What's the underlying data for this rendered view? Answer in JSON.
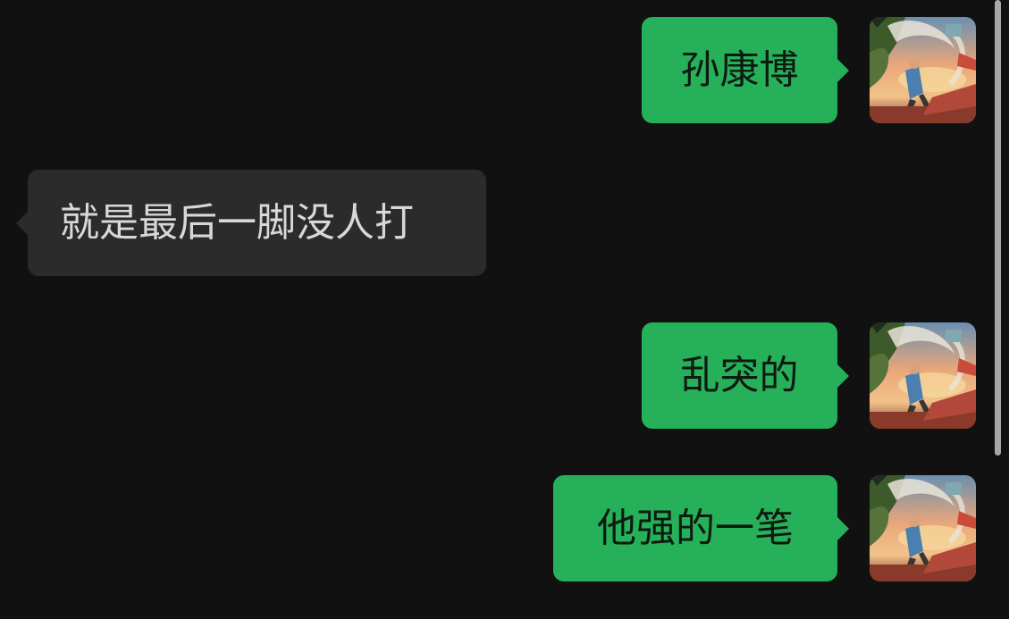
{
  "messages": [
    {
      "direction": "outgoing",
      "text": "孙康博"
    },
    {
      "direction": "incoming",
      "text": "就是最后一脚没人打"
    },
    {
      "direction": "outgoing",
      "text": "乱突的"
    },
    {
      "direction": "outgoing",
      "text": "他强的一笔"
    }
  ],
  "colors": {
    "background": "#111111",
    "outgoing_bubble": "#26b05a",
    "incoming_bubble": "#2b2b2b"
  },
  "icons": {
    "avatar": "avatar-illustration-icon"
  }
}
